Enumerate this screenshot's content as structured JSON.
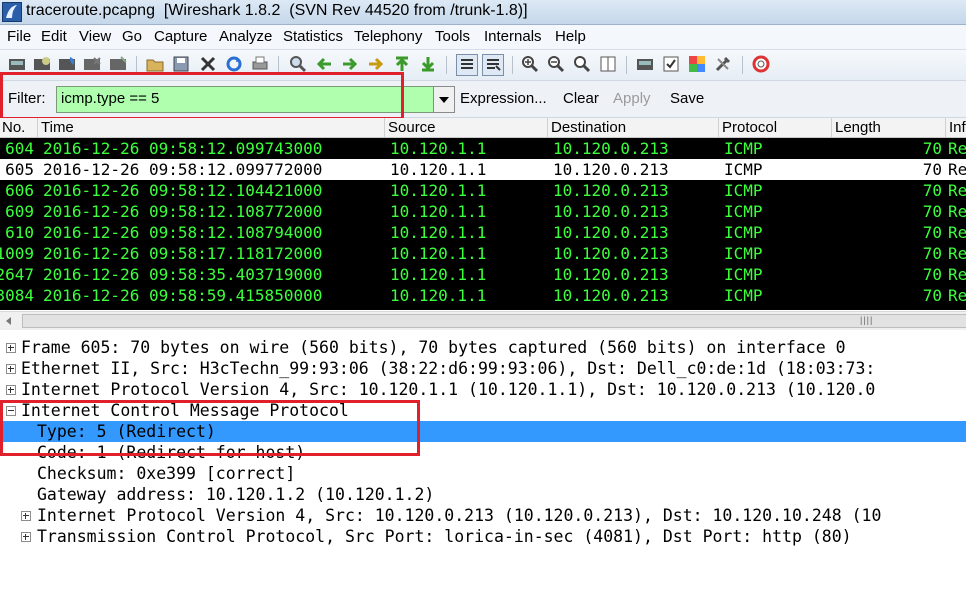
{
  "window": {
    "title": "traceroute.pcapng  [Wireshark 1.8.2  (SVN Rev 44520 from /trunk-1.8)]",
    "icon": "wireshark-fin-icon"
  },
  "menu": [
    "File",
    "Edit",
    "View",
    "Go",
    "Capture",
    "Analyze",
    "Statistics",
    "Telephony",
    "Tools",
    "Internals",
    "Help"
  ],
  "toolbar": {
    "icons": [
      "interface-list-icon",
      "capture-options-icon",
      "start-capture-icon",
      "stop-capture-icon",
      "restart-capture-icon",
      "open-file-icon",
      "save-file-icon",
      "close-file-icon",
      "reload-icon",
      "print-icon",
      "find-packet-icon",
      "go-back-icon",
      "go-forward-icon",
      "go-to-packet-icon",
      "go-first-icon",
      "go-last-icon",
      "colorize-icon",
      "auto-scroll-icon",
      "zoom-in-icon",
      "zoom-out-icon",
      "normal-size-icon",
      "resize-columns-icon",
      "capture-filters-icon",
      "display-filters-icon",
      "coloring-rules-icon",
      "preferences-icon",
      "help-icon"
    ]
  },
  "filter": {
    "label": "Filter:",
    "value": "icmp.type == 5",
    "valid_color": "#afffaf",
    "expression_label": "Expression...",
    "clear_label": "Clear",
    "apply_label": "Apply",
    "save_label": "Save"
  },
  "packet_list": {
    "columns": [
      "No.",
      "Time",
      "Source",
      "Destination",
      "Protocol",
      "Length",
      "Info"
    ],
    "rows": [
      {
        "no": "604",
        "time": "2016-12-26 09:58:12.099743000",
        "src": "10.120.1.1",
        "dst": "10.120.0.213",
        "proto": "ICMP",
        "len": "70",
        "info": "Re"
      },
      {
        "no": "605",
        "time": "2016-12-26 09:58:12.099772000",
        "src": "10.120.1.1",
        "dst": "10.120.0.213",
        "proto": "ICMP",
        "len": "70",
        "info": "Re"
      },
      {
        "no": "606",
        "time": "2016-12-26 09:58:12.104421000",
        "src": "10.120.1.1",
        "dst": "10.120.0.213",
        "proto": "ICMP",
        "len": "70",
        "info": "Re"
      },
      {
        "no": "609",
        "time": "2016-12-26 09:58:12.108772000",
        "src": "10.120.1.1",
        "dst": "10.120.0.213",
        "proto": "ICMP",
        "len": "70",
        "info": "Re"
      },
      {
        "no": "610",
        "time": "2016-12-26 09:58:12.108794000",
        "src": "10.120.1.1",
        "dst": "10.120.0.213",
        "proto": "ICMP",
        "len": "70",
        "info": "Re"
      },
      {
        "no": "1009",
        "time": "2016-12-26 09:58:17.118172000",
        "src": "10.120.1.1",
        "dst": "10.120.0.213",
        "proto": "ICMP",
        "len": "70",
        "info": "Re"
      },
      {
        "no": "2647",
        "time": "2016-12-26 09:58:35.403719000",
        "src": "10.120.1.1",
        "dst": "10.120.0.213",
        "proto": "ICMP",
        "len": "70",
        "info": "Re"
      },
      {
        "no": "3084",
        "time": "2016-12-26 09:58:59.415850000",
        "src": "10.120.1.1",
        "dst": "10.120.0.213",
        "proto": "ICMP",
        "len": "70",
        "info": "Re"
      }
    ],
    "selected_no": "605",
    "colors": {
      "row_bg": "#000000",
      "row_fg": "#3cff3c",
      "selected_bg": "#ffffff",
      "selected_fg": "#000000"
    }
  },
  "details": {
    "items": [
      {
        "text": "Frame 605: 70 bytes on wire (560 bits), 70 bytes captured (560 bits) on interface 0",
        "expander": "plus"
      },
      {
        "text": "Ethernet II, Src: H3cTechn_99:93:06 (38:22:d6:99:93:06), Dst: Dell_c0:de:1d (18:03:73:",
        "expander": "plus"
      },
      {
        "text": "Internet Protocol Version 4, Src: 10.120.1.1 (10.120.1.1), Dst: 10.120.0.213 (10.120.0",
        "expander": "plus"
      },
      {
        "text": "Internet Control Message Protocol",
        "expander": "minus"
      },
      {
        "text": "Type: 5 (Redirect)",
        "expander": "none",
        "selected": true
      },
      {
        "text": "Code: 1 (Redirect for host)",
        "expander": "none"
      },
      {
        "text": "Checksum: 0xe399 [correct]",
        "expander": "none"
      },
      {
        "text": "Gateway address: 10.120.1.2 (10.120.1.2)",
        "expander": "none"
      },
      {
        "text": "Internet Protocol Version 4, Src: 10.120.0.213 (10.120.0.213), Dst: 10.120.10.248 (10",
        "expander": "plus"
      },
      {
        "text": "Transmission Control Protocol, Src Port: lorica-in-sec (4081), Dst Port: http (80)",
        "expander": "plus"
      }
    ],
    "selected_color": "#3399ff"
  },
  "annotation_color": "#e0202a"
}
